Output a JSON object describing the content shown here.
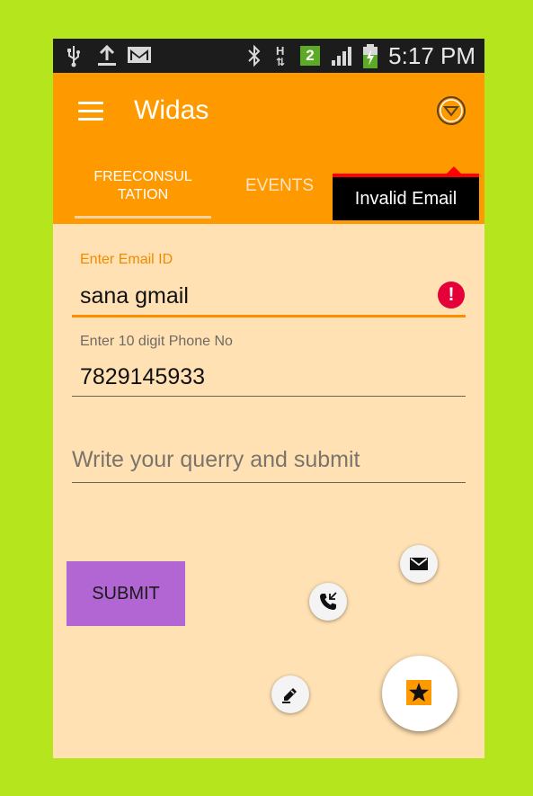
{
  "status_bar": {
    "time": "5:17 PM",
    "network_badge": "2",
    "network_type": "H",
    "icons": [
      "usb-icon",
      "upload-icon",
      "gmail-icon",
      "bluetooth-icon",
      "network-h-icon",
      "sim2-icon",
      "signal-icon",
      "battery-charging-icon"
    ]
  },
  "action_bar": {
    "title": "Widas",
    "menu_icon": "hamburger-menu-icon",
    "overflow_icon": "dropdown-circle-icon",
    "color": "#ff9900"
  },
  "tabs": [
    {
      "label": "FREECONSUL TATION",
      "selected": true
    },
    {
      "label": "EVENTS",
      "selected": false
    }
  ],
  "error_popup": {
    "text": "Invalid Email",
    "accent": "#ff0000"
  },
  "form": {
    "email_label": "Enter Email ID",
    "email_value": "sana gmail",
    "error_icon": "!",
    "phone_label": "Enter 10 digit Phone No",
    "phone_value": "7829145933",
    "query_placeholder": "Write your querry and submit",
    "submit_label": "SUBMIT"
  },
  "fab": {
    "main_icon": "star-icon",
    "items": [
      "mail-icon",
      "phone-call-icon",
      "edit-pencil-icon"
    ]
  },
  "colors": {
    "background": "#b5e61d",
    "content": "#ffe1b3",
    "accent": "#ff8c00",
    "submit": "#b266d4",
    "error": "#e6003a"
  }
}
